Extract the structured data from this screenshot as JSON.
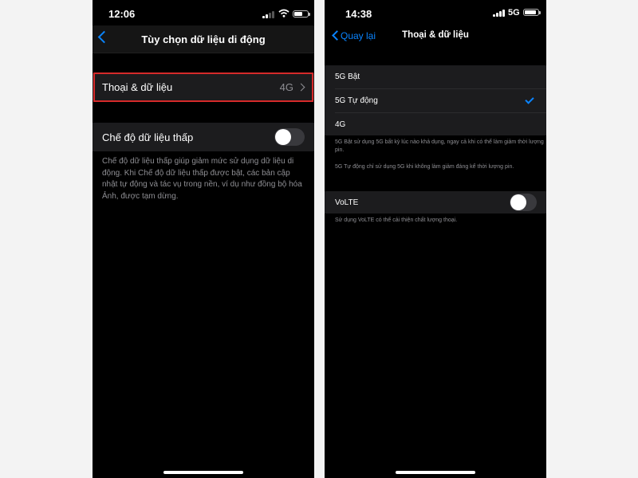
{
  "left_screen": {
    "status_bar": {
      "time": "12:06",
      "battery_level": 0.6
    },
    "nav": {
      "title": "Tùy chọn dữ liệu di động",
      "back_icon": "chevron-left-icon"
    },
    "voice_data_row": {
      "label": "Thoại & dữ liệu",
      "value": "4G"
    },
    "low_data_mode": {
      "label": "Chế độ dữ liệu thấp",
      "enabled": false,
      "description": "Chế độ dữ liệu thấp giúp giảm mức sử dụng dữ liệu di động. Khi Chế độ dữ liệu thấp được bật, các bản cập nhật tự động và tác vụ trong nền, ví dụ như đồng bộ hóa Ảnh, được tạm dừng."
    },
    "highlight_color": "#d62a2a"
  },
  "right_screen": {
    "status_bar": {
      "time": "14:38",
      "network": "5G",
      "battery_level": 0.85
    },
    "nav": {
      "back_label": "Quay lại",
      "title": "Thoại & dữ liệu"
    },
    "options": [
      {
        "label": "5G Bật",
        "selected": false
      },
      {
        "label": "5G Tự động",
        "selected": true
      },
      {
        "label": "4G",
        "selected": false
      }
    ],
    "footnotes": [
      "5G Bật sử dụng 5G bất kỳ lúc nào khả dụng, ngay cả khi có thể làm giảm thời lượng pin.",
      "5G Tự động chỉ sử dụng 5G khi không làm giảm đáng kể thời lượng pin."
    ],
    "volte": {
      "label": "VoLTE",
      "enabled": false,
      "description": "Sử dụng VoLTE có thể cải thiện chất lượng thoại."
    }
  },
  "colors": {
    "accent": "#0a84ff",
    "cell_bg": "#1c1c1e",
    "secondary_text": "#8e8e93"
  }
}
